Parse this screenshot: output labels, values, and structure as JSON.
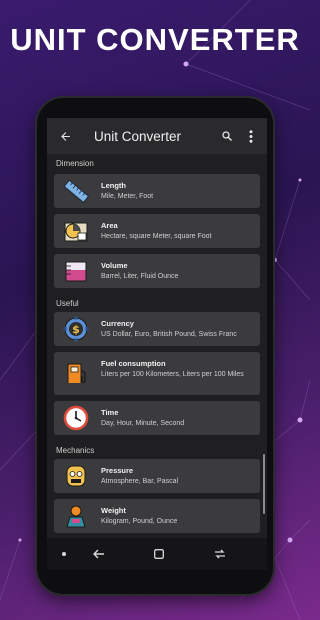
{
  "promo": {
    "title": "UNIT CONVERTER"
  },
  "appbar": {
    "title": "Unit Converter",
    "back_icon": "arrow-back-icon",
    "search_icon": "search-icon",
    "more_icon": "more-vert-icon"
  },
  "sections": [
    {
      "title": "Dimension"
    },
    {
      "title": "Useful"
    },
    {
      "title": "Mechanics"
    }
  ],
  "items": [
    {
      "name": "Length",
      "desc": "Mile, Meter, Foot",
      "icon": "ruler-icon"
    },
    {
      "name": "Area",
      "desc": "Hectare, square Meter, square Foot",
      "icon": "area-icon"
    },
    {
      "name": "Volume",
      "desc": "Barrel, Liter, Fluid Ounce",
      "icon": "beaker-icon"
    },
    {
      "name": "Currency",
      "desc": "US Dollar, Euro, British Pound, Swiss Franc",
      "icon": "currency-icon"
    },
    {
      "name": "Fuel consumption",
      "desc": "Liters per 100 Kilometers, Liters per 100 Miles",
      "icon": "fuel-pump-icon"
    },
    {
      "name": "Time",
      "desc": "Day, Hour, Minute, Second",
      "icon": "clock-icon"
    },
    {
      "name": "Pressure",
      "desc": "Atmosphere, Bar, Pascal",
      "icon": "pressure-icon"
    },
    {
      "name": "Weight",
      "desc": "Kilogram, Pound, Ounce",
      "icon": "weight-icon"
    }
  ],
  "navbar": {
    "dot_icon": "nav-dot-icon",
    "back_icon": "nav-back-icon",
    "home_icon": "nav-home-icon",
    "recents_icon": "nav-recents-icon"
  }
}
